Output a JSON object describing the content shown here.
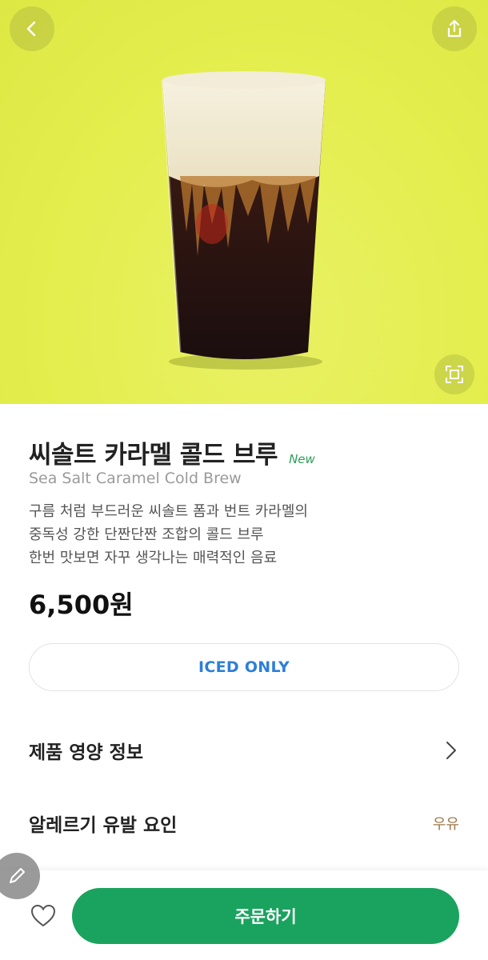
{
  "product": {
    "name_ko": "씨솔트 카라멜 콜드 브루",
    "badge": "New",
    "name_en": "Sea Salt Caramel Cold Brew",
    "description_lines": [
      "구름 처럼 부드러운 씨솔트 폼과 번트 카라멜의",
      "중독성 강한 단짠단짠 조합의 콜드 브루",
      "한번 맛보면 자꾸 생각나는 매력적인 음료"
    ],
    "price": "6,500원",
    "temperature_option": "ICED ONLY"
  },
  "info_rows": {
    "nutrition_label": "제품 영양 정보",
    "allergy_label": "알레르기 유발 요인",
    "allergy_value": "우유"
  },
  "actions": {
    "order_label": "주문하기"
  },
  "icons": {
    "back": "chevron-left-icon",
    "share": "share-icon",
    "fullscreen": "fullscreen-icon",
    "nutrition_chevron": "chevron-right-icon",
    "edit": "pencil-icon",
    "favorite": "heart-icon"
  },
  "colors": {
    "hero_background": "#e4ee4e",
    "order_button": "#1aa35e",
    "new_badge": "#2f9e5a",
    "iced_label": "#2d7fd6",
    "allergy_value": "#9b7a4b"
  }
}
